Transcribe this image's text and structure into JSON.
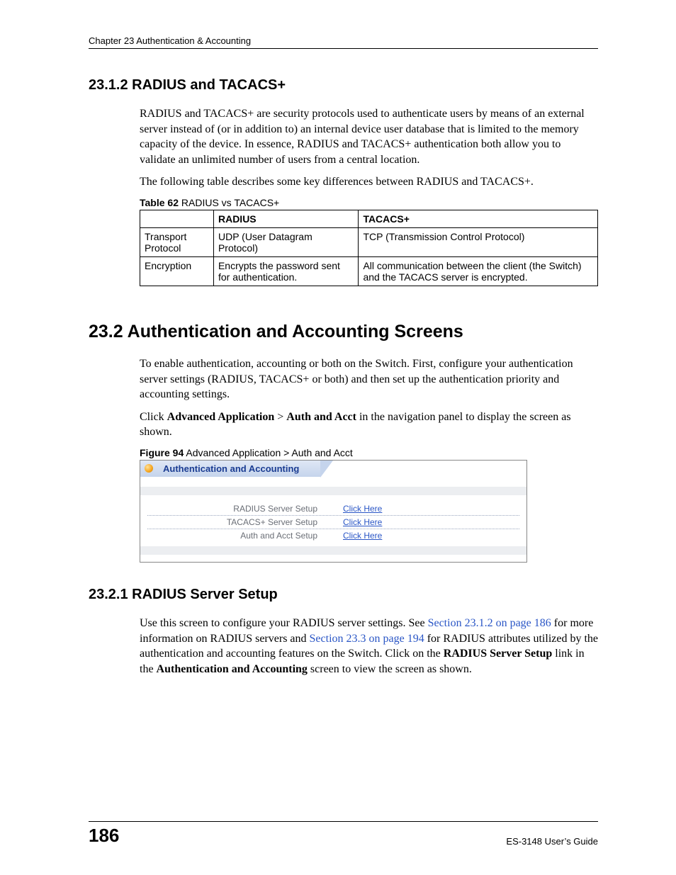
{
  "header": {
    "running": "Chapter 23 Authentication & Accounting"
  },
  "s2312": {
    "heading": "23.1.2  RADIUS and TACACS+",
    "p1": "RADIUS and TACACS+ are security protocols used to authenticate users by means of an external server instead of (or in addition to) an internal device user database that is limited to the memory capacity of the device. In essence, RADIUS and TACACS+ authentication both allow you to validate an unlimited number of users from a central location.",
    "p2": "The following table describes some key differences between RADIUS and TACACS+.",
    "table_caption_lead": "Table 62",
    "table_caption_rest": "   RADIUS vs TACACS+",
    "table": {
      "head": [
        "",
        "RADIUS",
        "TACACS+"
      ],
      "rows": [
        [
          "Transport Protocol",
          "UDP (User Datagram Protocol)",
          "TCP (Transmission Control Protocol)"
        ],
        [
          "Encryption",
          "Encrypts the password sent for authentication.",
          "All communication between the client (the Switch) and the TACACS server is encrypted."
        ]
      ]
    }
  },
  "s232": {
    "heading": "23.2  Authentication and Accounting Screens",
    "p1": "To enable authentication, accounting or both on the Switch. First, configure your authentication server settings (RADIUS, TACACS+ or both) and then set up the authentication priority and accounting settings.",
    "p2a": "Click ",
    "p2b": "Advanced Application",
    "p2c": " > ",
    "p2d": "Auth and Acct",
    "p2e": " in the navigation panel to display the screen as shown.",
    "fig_caption_lead": "Figure 94",
    "fig_caption_rest": "   Advanced Application > Auth and Acct",
    "figure": {
      "title": "Authentication and Accounting",
      "rows": [
        {
          "label": "RADIUS Server Setup",
          "link": "Click Here"
        },
        {
          "label": "TACACS+ Server Setup",
          "link": "Click Here"
        },
        {
          "label": "Auth and Acct Setup",
          "link": "Click Here"
        }
      ]
    }
  },
  "s2321": {
    "heading": "23.2.1  RADIUS Server Setup",
    "p1a": "Use this screen to configure your RADIUS server settings. See ",
    "p1b": "Section 23.1.2 on page 186",
    "p1c": " for more information on RADIUS servers and ",
    "p1d": "Section 23.3 on page 194",
    "p1e": " for RADIUS attributes utilized by the authentication and accounting features on the Switch. Click on the ",
    "p1f": "RADIUS Server Setup",
    "p1g": " link in the ",
    "p1h": "Authentication and Accounting",
    "p1i": " screen to view the screen as shown."
  },
  "footer": {
    "page": "186",
    "guide": "ES-3148 User’s Guide"
  }
}
